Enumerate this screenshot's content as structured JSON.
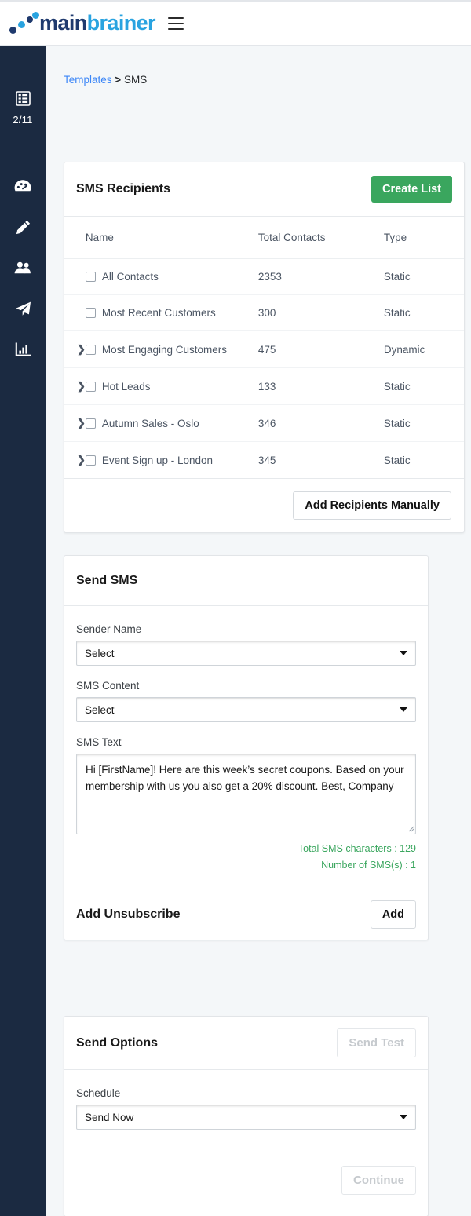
{
  "brand": {
    "name_dark": "main",
    "name_light": "brainer",
    "menu_icon": "hamburger-icon"
  },
  "sidebar": {
    "counter": "2/11",
    "items": [
      {
        "icon": "list-grid-icon"
      },
      {
        "icon": "dashboard-gauge-icon"
      },
      {
        "icon": "pencil-icon"
      },
      {
        "icon": "users-icon"
      },
      {
        "icon": "paper-plane-icon"
      },
      {
        "icon": "bar-chart-icon"
      }
    ]
  },
  "breadcrumb": {
    "parent": "Templates",
    "separator": ">",
    "current": "SMS"
  },
  "recipients": {
    "title": "SMS Recipients",
    "create_button": "Create List",
    "columns": [
      "Name",
      "Total Contacts",
      "Type"
    ],
    "rows": [
      {
        "expandable": false,
        "name": "All Contacts",
        "total": "2353",
        "type": "Static"
      },
      {
        "expandable": false,
        "name": "Most Recent Customers",
        "total": "300",
        "type": "Static"
      },
      {
        "expandable": true,
        "name": "Most Engaging Customers",
        "total": "475",
        "type": "Dynamic"
      },
      {
        "expandable": true,
        "name": "Hot Leads",
        "total": "133",
        "type": "Static"
      },
      {
        "expandable": true,
        "name": "Autumn Sales - Oslo",
        "total": "346",
        "type": "Static"
      },
      {
        "expandable": true,
        "name": "Event Sign up - London",
        "total": "345",
        "type": "Static"
      }
    ],
    "add_manually_button": "Add Recipients Manually"
  },
  "send_sms": {
    "title": "Send SMS",
    "sender_name_label": "Sender Name",
    "sender_name_value": "Select",
    "sms_content_label": "SMS Content",
    "sms_content_value": "Select",
    "sms_text_label": "SMS Text",
    "sms_text_value": "Hi [FirstName]! Here are this week’s secret coupons. Based on your membership with us you also get a 20% discount. Best, Company",
    "total_characters": "Total SMS characters : 129",
    "number_of_sms": "Number of SMS(s) : 1",
    "unsubscribe_label": "Add Unsubscribe",
    "add_button": "Add"
  },
  "send_options": {
    "title": "Send Options",
    "send_test_button": "Send Test",
    "schedule_label": "Schedule",
    "schedule_value": "Send Now",
    "continue_button": "Continue"
  },
  "colors": {
    "brand_dark": "#1f3a6e",
    "brand_light": "#29a3e0",
    "sidebar_bg": "#1b2a41",
    "page_bg": "#f4f7f9",
    "accent_green": "#3aa65e",
    "link_blue": "#3b86f7"
  }
}
